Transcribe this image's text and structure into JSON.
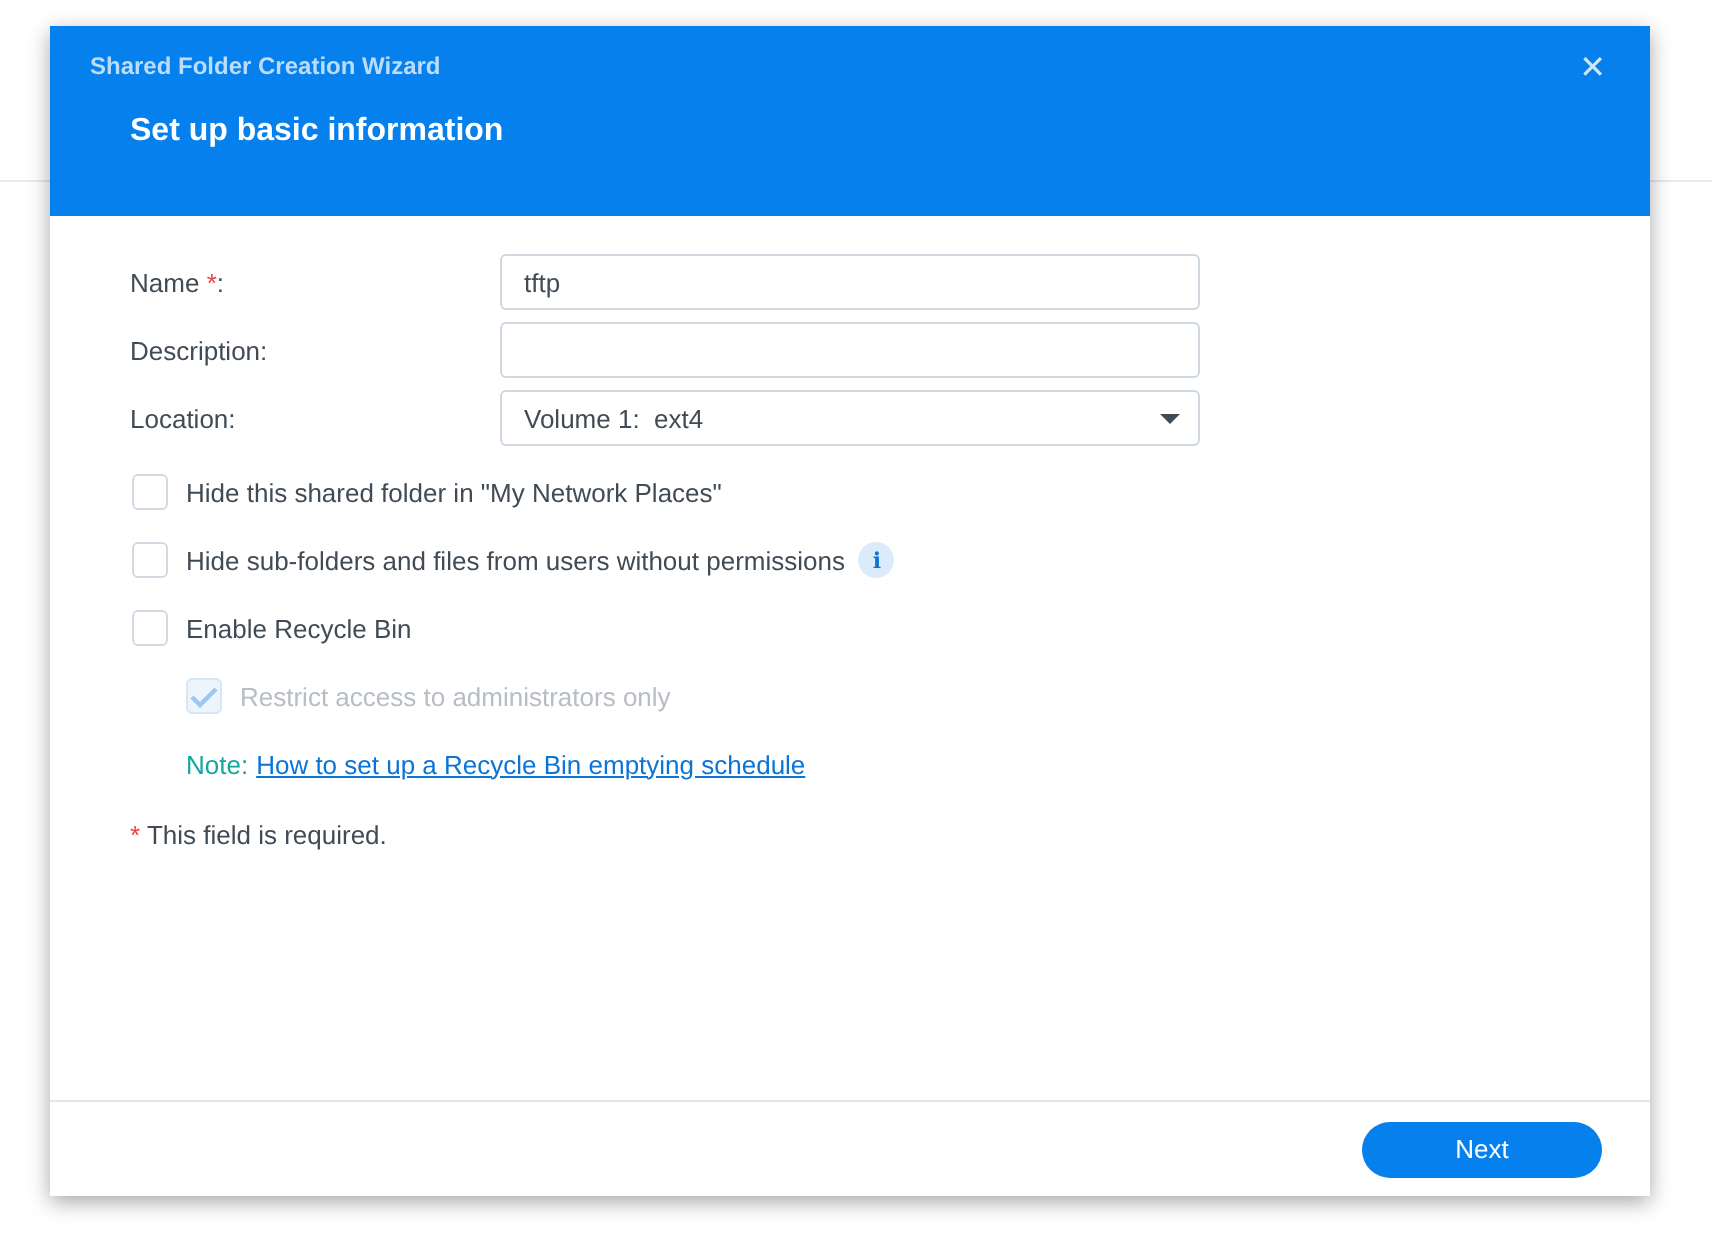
{
  "window": {
    "title": "Shared Folder Creation Wizard",
    "close": "✕"
  },
  "step_title": "Set up basic information",
  "fields": [
    {
      "label": "Name",
      "required_mark": "*",
      "suffix": ":",
      "kind": "text",
      "value": "tftp"
    },
    {
      "label": "Description:",
      "kind": "text"
    },
    {
      "label": "Location:",
      "kind": "select",
      "value": "Volume 1:  ext4"
    }
  ],
  "options": [
    {
      "kind": "checkbox",
      "label": "Hide this shared folder in \"My Network Places\"",
      "checked": false,
      "disabled": false,
      "nested": false
    },
    {
      "kind": "checkbox",
      "label": "Hide sub-folders and files from users without permissions",
      "checked": false,
      "disabled": false,
      "nested": false,
      "info": "i"
    },
    {
      "kind": "checkbox",
      "label": "Enable Recycle Bin",
      "checked": false,
      "disabled": false,
      "nested": false
    },
    {
      "kind": "checkbox",
      "label": "Restrict access to administrators only",
      "checked": true,
      "disabled": true,
      "nested": true
    },
    {
      "kind": "note",
      "prefix": "Note:",
      "link": "How to set up a Recycle Bin emptying schedule",
      "nested": true
    }
  ],
  "footnote": {
    "mark": "*",
    "text": "This field is required."
  },
  "buttons": [
    {
      "label": "Next"
    }
  ]
}
